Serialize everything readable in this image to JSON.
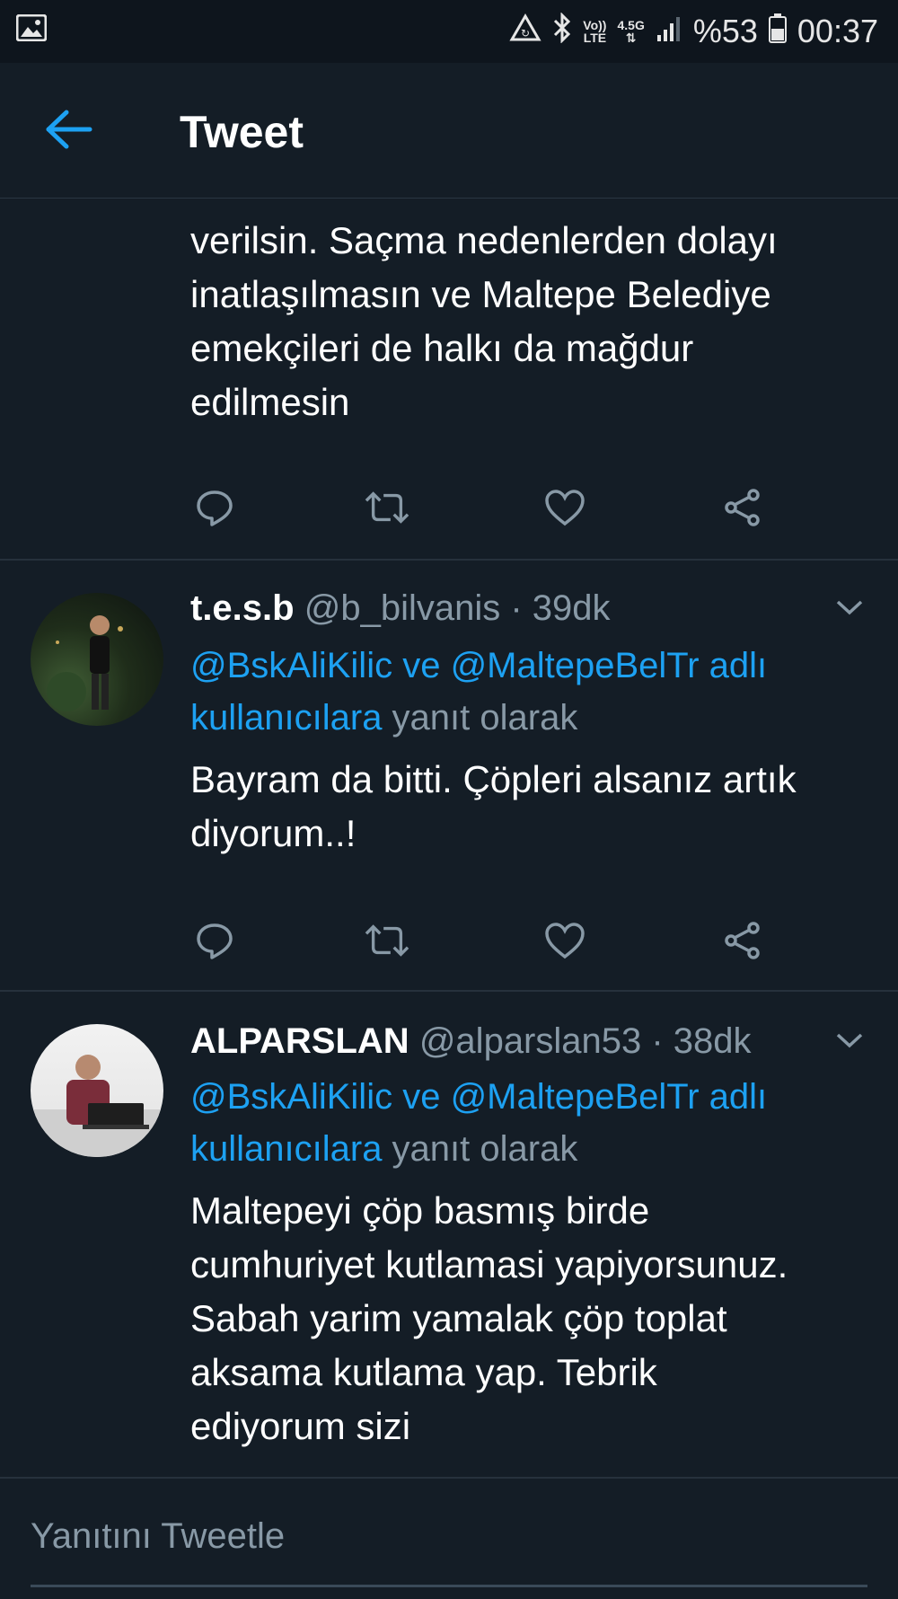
{
  "status_bar": {
    "icons": [
      "gallery-icon",
      "data-saver-icon",
      "bluetooth-icon",
      "volte-icon",
      "network-icon",
      "signal-icon",
      "battery-icon"
    ],
    "volte_top": "Vo))",
    "volte_bottom": "LTE",
    "network_type": "4.5G",
    "battery": "%53",
    "time": "00:37"
  },
  "header": {
    "title": "Tweet"
  },
  "colors": {
    "background": "#141d26",
    "accent": "#1da1f2",
    "muted": "#8899a6"
  },
  "tweets": [
    {
      "text": "verilsin. Saçma nedenlerden dolayı\ninatlaşılmasın ve Maltepe Belediye\nemekçileri de halkı da mağdur\nedilmesin"
    },
    {
      "name": "t.e.s.b",
      "handle": "@b_bilvanis · 39dk",
      "mention_1": "@BskAliKilic",
      "connector": " ve ",
      "mention_2": "@MaltepeBelTr",
      "mention_3": " adlı kullanıcılara",
      "reply_suffix": " yanıt olarak",
      "text": "Bayram da bitti. Çöpleri alsanız artık\ndiyorum..!"
    },
    {
      "name": "ALPARSLAN",
      "handle": "@alparslan53 · 38dk",
      "mention_1": "@BskAliKilic",
      "connector": " ve ",
      "mention_2": "@MaltepeBelTr",
      "mention_3": " adlı kullanıcılara",
      "reply_suffix": " yanıt olarak",
      "text": "Maltepeyi çöp basmış birde\ncumhuriyet kutlamasi yapiyorsunuz.\nSabah yarim yamalak çöp toplat\naksama kutlama yap. Tebrik\nediyorum sizi"
    }
  ],
  "composer": {
    "placeholder": "Yanıtını Tweetle"
  }
}
